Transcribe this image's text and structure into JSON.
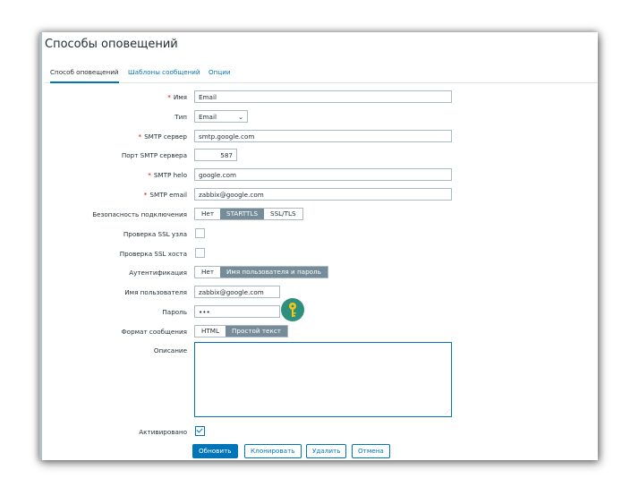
{
  "page": {
    "title": "Способы оповещений"
  },
  "tabs": [
    "Способ оповещений",
    "Шаблоны сообщений",
    "Опции"
  ],
  "form": {
    "name": {
      "label": "Имя",
      "value": "Email"
    },
    "type": {
      "label": "Тип",
      "value": "Email"
    },
    "smtp_server": {
      "label": "SMTP сервер",
      "value": "smtp.google.com"
    },
    "smtp_port": {
      "label": "Порт SMTP сервера",
      "value": "587"
    },
    "smtp_helo": {
      "label": "SMTP helo",
      "value": "google.com"
    },
    "smtp_email": {
      "label": "SMTP email",
      "value": "zabbix@google.com"
    },
    "security": {
      "label": "Безопасность подключения",
      "options": [
        "Нет",
        "STARTTLS",
        "SSL/TLS"
      ],
      "selected": "STARTTLS"
    },
    "ssl_verify_peer": {
      "label": "Проверка SSL узла",
      "checked": false
    },
    "ssl_verify_host": {
      "label": "Проверка SSL хоста",
      "checked": false
    },
    "auth": {
      "label": "Аутентификация",
      "options": [
        "Нет",
        "Имя пользователя и пароль"
      ],
      "selected": "Имя пользователя и пароль"
    },
    "username": {
      "label": "Имя пользователя",
      "value": "zabbix@google.com"
    },
    "password": {
      "label": "Пароль",
      "value": "•••"
    },
    "message_format": {
      "label": "Формат сообщения",
      "options": [
        "HTML",
        "Простой текст"
      ],
      "selected": "Простой текст"
    },
    "description": {
      "label": "Описание",
      "value": ""
    },
    "enabled": {
      "label": "Активировано",
      "checked": true
    }
  },
  "buttons": {
    "update": "Обновить",
    "clone": "Клонировать",
    "delete": "Удалить",
    "cancel": "Отмена"
  },
  "required_marker": "*",
  "icons": {
    "dropdown": "chevron-down-icon",
    "key": "key-icon"
  },
  "colors": {
    "accent": "#0275b8",
    "segment_active": "#768d99",
    "key_badge": "#2e8f7d",
    "required": "#d40000"
  }
}
